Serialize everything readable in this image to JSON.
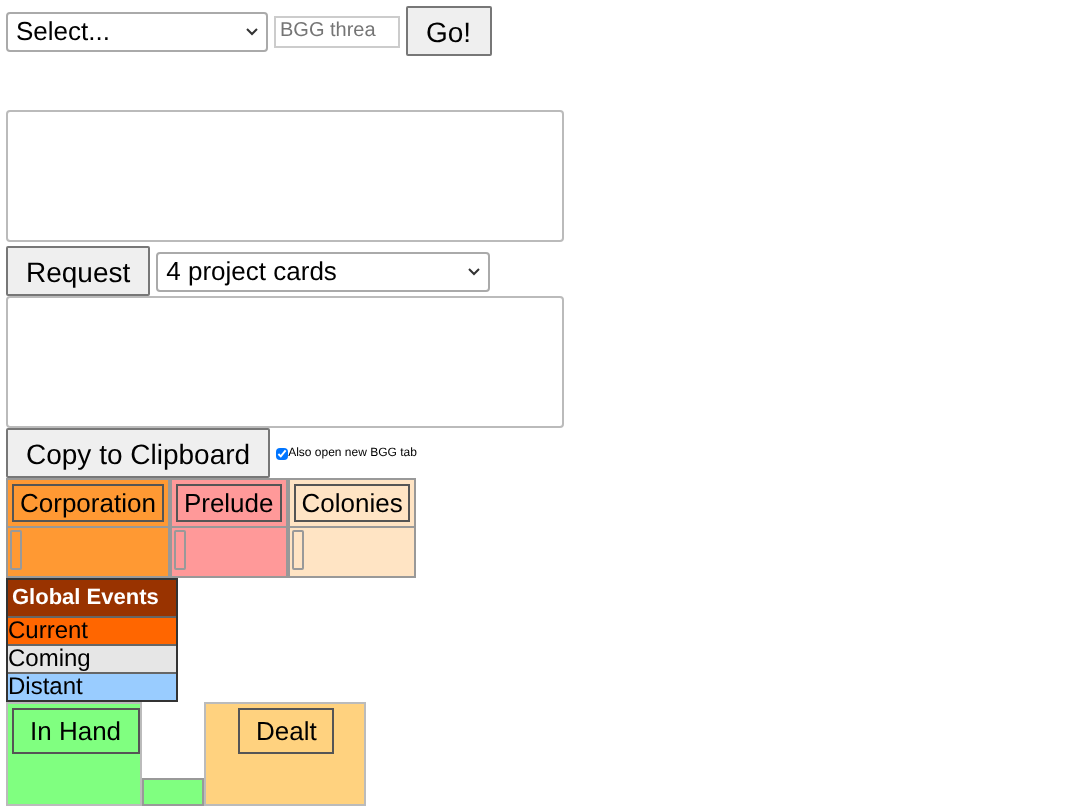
{
  "top_bar": {
    "select": "Select...",
    "thread_field": {
      "placeholder": "BGG threa"
    },
    "go_button": "Go!"
  },
  "request_bar": {
    "button": "Request",
    "select": "4 project cards"
  },
  "copy_bar": {
    "button": "Copy to Clipboard",
    "checkbox": {
      "label": "Also open new BGG tab",
      "checked": true
    }
  },
  "decks": [
    {
      "label": "Corporation",
      "color": "#ff9933"
    },
    {
      "label": "Prelude",
      "color": "#ff9999"
    },
    {
      "label": "Colonies",
      "color": "#ffe4c4"
    }
  ],
  "global_events": {
    "title": "Global Events",
    "rows": [
      {
        "label": "Current",
        "color": "#ff6600"
      },
      {
        "label": "Coming",
        "color": "#e6e6e6"
      },
      {
        "label": "Distant",
        "color": "#99ccff"
      }
    ]
  },
  "hands": [
    {
      "label": "In Hand",
      "color": "#80ff80"
    },
    {
      "label": "Dealt",
      "color": "#ffd27f"
    }
  ]
}
